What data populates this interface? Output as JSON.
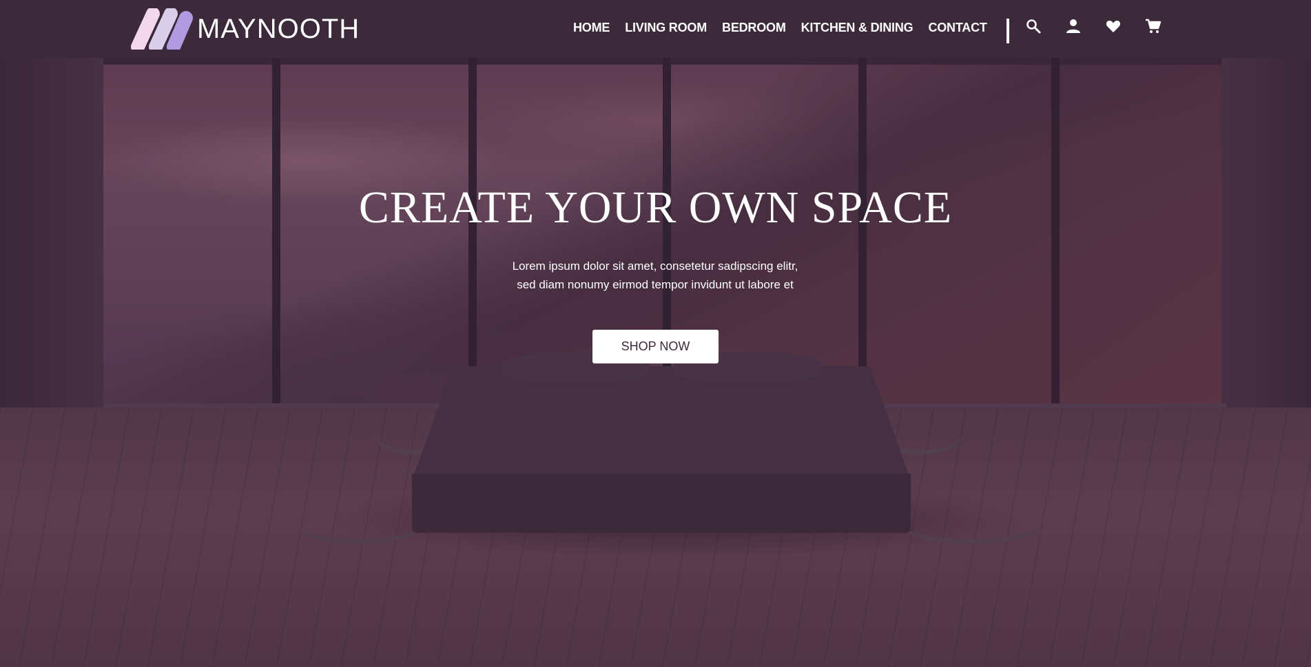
{
  "brand": {
    "name": "MAYNOOTH",
    "colors": {
      "header": "#3c2a3b",
      "logo_pink": "#f3d7ea",
      "logo_lilac": "#d9cfea",
      "logo_purple": "#b09be0",
      "text": "#ffffff"
    }
  },
  "nav": {
    "items": [
      {
        "label": "HOME"
      },
      {
        "label": "LIVING ROOM"
      },
      {
        "label": "BEDROOM"
      },
      {
        "label": "KITCHEN & DINING"
      },
      {
        "label": "CONTACT"
      }
    ]
  },
  "header_icons": [
    "search-icon",
    "user-icon",
    "heart-icon",
    "cart-icon"
  ],
  "hero": {
    "title": "CREATE YOUR OWN SPACE",
    "subtitle_line1": "Lorem ipsum dolor sit amet, consetetur sadipscing elitr,",
    "subtitle_line2": "sed diam nonumy eirmod tempor invidunt ut labore et",
    "cta_label": "SHOP NOW"
  }
}
